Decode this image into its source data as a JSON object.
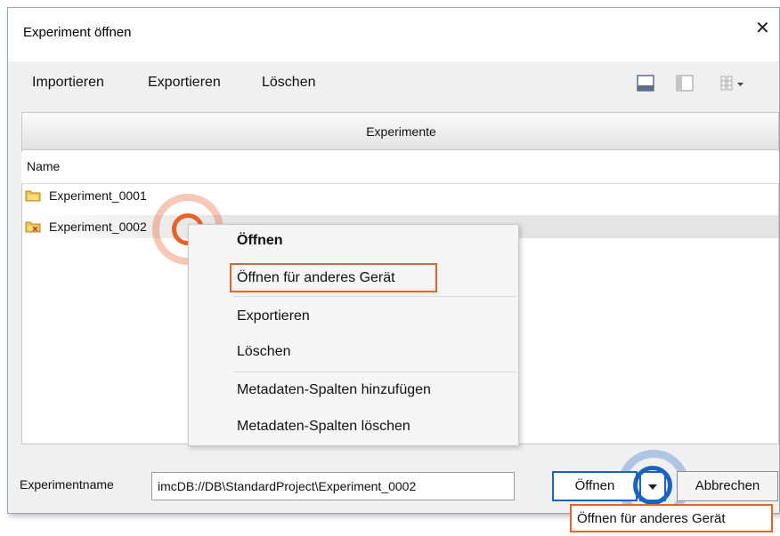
{
  "window": {
    "title": "Experiment öffnen",
    "close_glyph": "✕"
  },
  "toolbar": {
    "import_label": "Importieren",
    "export_label": "Exportieren",
    "delete_label": "Löschen",
    "icons": [
      "layout-bottom-panel-icon",
      "layout-side-panel-icon",
      "columns-view-icon"
    ]
  },
  "panel": {
    "header": "Experimente",
    "column_name": "Name"
  },
  "experiments": [
    {
      "name": "Experiment_0001",
      "selected": false
    },
    {
      "name": "Experiment_0002",
      "selected": true
    }
  ],
  "context_menu": {
    "open": "Öffnen",
    "open_other_device": "Öffnen für anderes Gerät",
    "export": "Exportieren",
    "delete": "Löschen",
    "add_metadata_columns": "Metadaten-Spalten hinzufügen",
    "delete_metadata_columns": "Metadaten-Spalten löschen"
  },
  "footer": {
    "name_label": "Experimentname",
    "path_value": "imcDB://DB\\StandardProject\\Experiment_0002",
    "open_button": "Öffnen",
    "cancel_button": "Abbrechen",
    "dropdown_item": "Öffnen für anderes Gerät"
  },
  "colors": {
    "highlight_orange": "#e8622a",
    "accent_blue": "#1a62c8",
    "selection_gray": "#e4e4e4"
  }
}
